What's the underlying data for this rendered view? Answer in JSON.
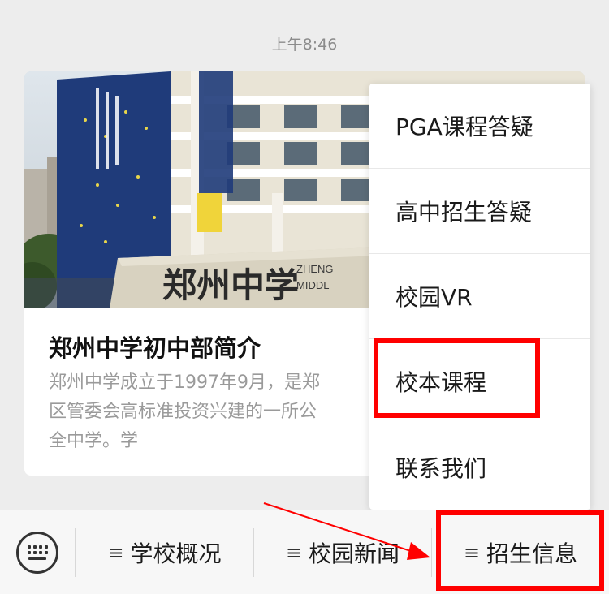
{
  "chat": {
    "timestamp": "上午8:46"
  },
  "article": {
    "image_alt": "郑州中学",
    "sign_text": "郑州中学",
    "sign_text_en_1": "ZHENG",
    "sign_text_en_2": "MIDDL",
    "title": "郑州中学初中部简介",
    "desc_line1": "郑州中学成立于1997年9月，是郑",
    "desc_line2": "区管委会高标准投资兴建的一所公",
    "desc_line3": "全中学。学"
  },
  "popup_menu": {
    "items": [
      {
        "label": "PGA课程答疑"
      },
      {
        "label": "高中招生答疑"
      },
      {
        "label": "校园VR"
      },
      {
        "label": "校本课程"
      },
      {
        "label": "联系我们"
      }
    ]
  },
  "bottom_bar": {
    "tabs": [
      {
        "label": "学校概况"
      },
      {
        "label": "校园新闻"
      },
      {
        "label": "招生信息"
      }
    ],
    "menu_glyph": "≡",
    "keyboard_icon": "keyboard-icon"
  },
  "colors": {
    "highlight": "#ff0000",
    "background": "#ededed"
  }
}
